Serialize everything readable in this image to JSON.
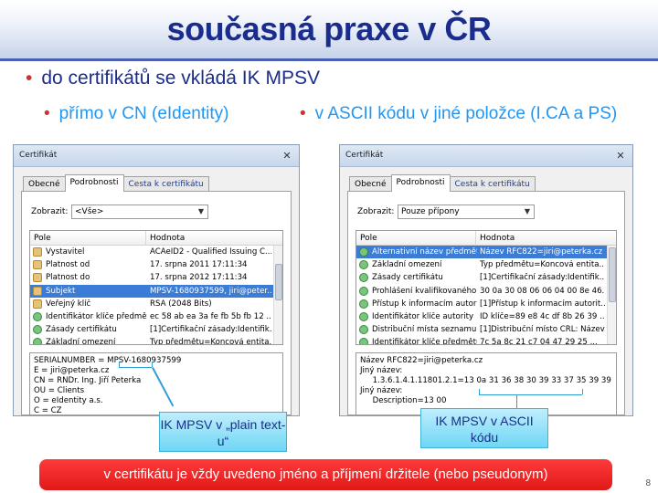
{
  "slide": {
    "title": "současná praxe v ČR",
    "bullet_main": "do certifikátů se vkládá IK MPSV",
    "bullet_sub_left": "přímo v CN (eIdentity)",
    "bullet_sub_right": "v ASCII kódu v jiné položce (I.CA a PS)",
    "bottom_banner": "v certifikátu je vždy uvedeno jméno a příjmení držitele (nebo pseudonym)",
    "page_number": "8",
    "callout_left": "IK MPSV v „plain text-u“",
    "callout_right": "IK MPSV v ASCII kódu",
    "colors": {
      "title": "#1b2d8c",
      "bullet_dot": "#d32f2f",
      "sub_bullet_text": "#2196f3",
      "banner": "#e01818",
      "callout": "#6fd6f5"
    }
  },
  "dialog_left": {
    "window_title": "Certifikát",
    "tabs": [
      "Obecné",
      "Podrobnosti",
      "Cesta k certifikátu"
    ],
    "show_label": "Zobrazit:",
    "show_value": "<Vše>",
    "col_field": "Pole",
    "col_value": "Hodnota",
    "rows": [
      {
        "field": "Vystavitel",
        "value": "ACAeID2 - Qualified Issuing C...",
        "icon": "cert"
      },
      {
        "field": "Platnost od",
        "value": "17. srpna 2011 17:11:34",
        "icon": "cert"
      },
      {
        "field": "Platnost do",
        "value": "17. srpna 2012 17:11:34",
        "icon": "cert"
      },
      {
        "field": "Subjekt",
        "value": "MPSV-1680937599, jiri@peter...",
        "icon": "cert"
      },
      {
        "field": "Veřejný klíč",
        "value": "RSA (2048 Bits)",
        "icon": "cert"
      },
      {
        "field": "Identifikátor klíče předmětu",
        "value": "ec 58 ab ea 3a fe fb 5b fb 12 ...",
        "icon": "green"
      },
      {
        "field": "Zásady certifikátu",
        "value": "[1]Certifikační zásady:Identifik...",
        "icon": "green"
      },
      {
        "field": "Základní omezení",
        "value": "Typ předmětu=Koncová entita...",
        "icon": "green"
      }
    ],
    "detail_lines": [
      "SERIALNUMBER = MPSV-1680937599",
      "E = jiri@peterka.cz",
      "CN = RNDr. Ing. Jiří Peterka",
      "OU = Clients",
      "O = eIdentity a.s.",
      "C = CZ"
    ]
  },
  "dialog_right": {
    "window_title": "Certifikát",
    "tabs": [
      "Obecné",
      "Podrobnosti",
      "Cesta k certifikátu"
    ],
    "show_label": "Zobrazit:",
    "show_value": "Pouze přípony",
    "col_field": "Pole",
    "col_value": "Hodnota",
    "rows": [
      {
        "field": "Alternativní název předmětu",
        "value": "Název RFC822=jiri@peterka.cz",
        "icon": "green"
      },
      {
        "field": "Základní omezení",
        "value": "Typ předmětu=Koncová entita...",
        "icon": "green"
      },
      {
        "field": "Zásady certifikátu",
        "value": "[1]Certifikační zásady:Identifik...",
        "icon": "green"
      },
      {
        "field": "Prohlášení kvalifikovaného c...",
        "value": "30 0a 30 08 06 06 04 00 8e 46...",
        "icon": "green"
      },
      {
        "field": "Přístup k informacím autority",
        "value": "[1]Přístup k informacím autorit...",
        "icon": "green"
      },
      {
        "field": "Identifikátor klíče autority",
        "value": "ID klíče=89 e8 4c df 8b 26 39 ...",
        "icon": "green"
      },
      {
        "field": "Distribuční místa seznamu o...",
        "value": "[1]Distribuční místo CRL: Název...",
        "icon": "green"
      },
      {
        "field": "Identifikátor klíče předmětu",
        "value": "7c 5a 8c 21 c7 04 47 29 25 ...",
        "icon": "green"
      }
    ],
    "detail_lines": [
      "Název RFC822=jiri@peterka.cz",
      "Jiný název:",
      "     1.3.6.1.4.1.11801.2.1=13 0a 31 36 38 30 39 33 37 35 39 39",
      "Jiný název:",
      "     Description=13 00"
    ]
  }
}
